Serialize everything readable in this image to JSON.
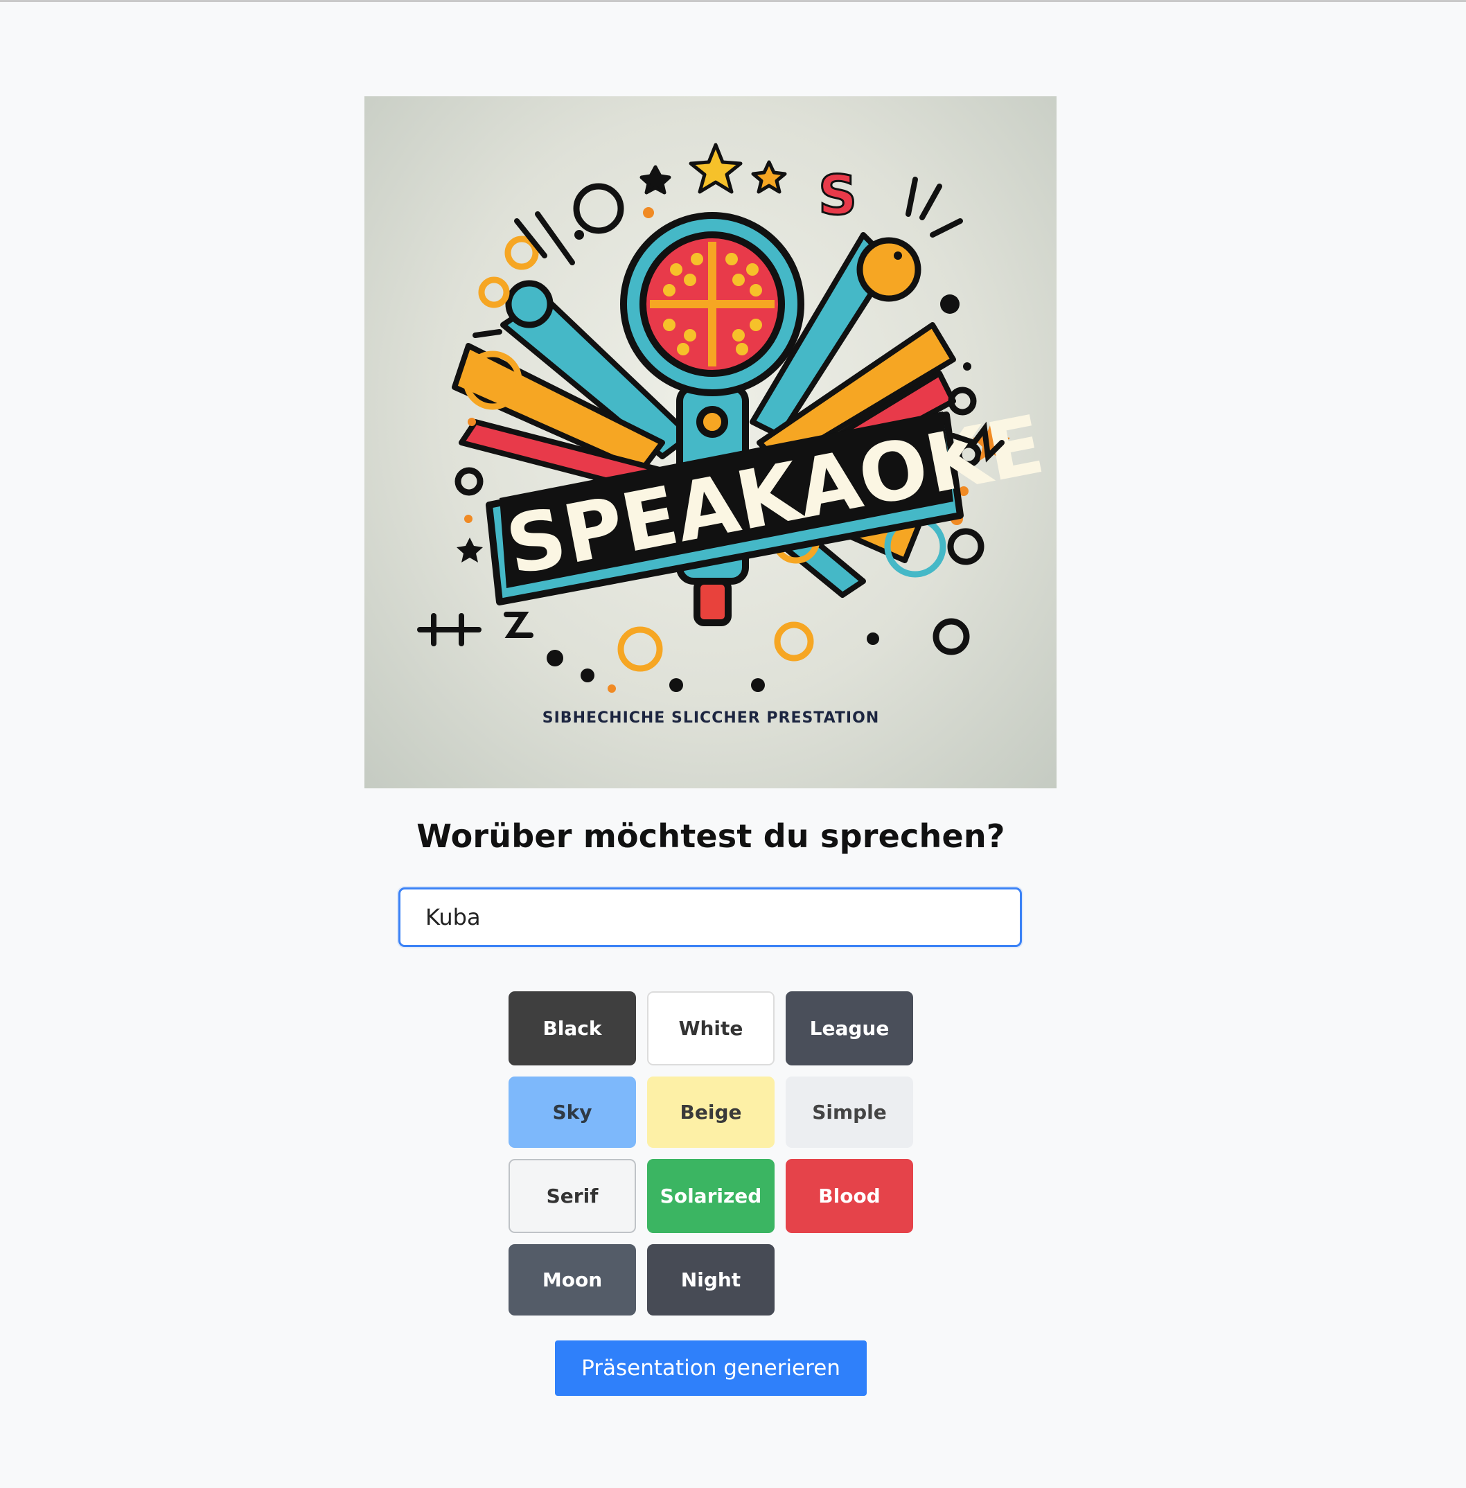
{
  "logo": {
    "wordmark": "SPEAKAOKE",
    "tagline": "SIBHECHICHE SLICCHER PRESTATION"
  },
  "prompt": {
    "heading": "Worüber möchtest du sprechen?"
  },
  "topic_input": {
    "value": "Kuba"
  },
  "themes": [
    {
      "label": "Black"
    },
    {
      "label": "White"
    },
    {
      "label": "League"
    },
    {
      "label": "Sky"
    },
    {
      "label": "Beige"
    },
    {
      "label": "Simple"
    },
    {
      "label": "Serif"
    },
    {
      "label": "Solarized"
    },
    {
      "label": "Blood"
    },
    {
      "label": "Moon"
    },
    {
      "label": "Night"
    }
  ],
  "generate_button": {
    "label": "Präsentation generieren"
  },
  "colors": {
    "accent": "#2f80fa",
    "input_focus_border": "#3b82f6",
    "page_background": "#f8f9fa"
  }
}
